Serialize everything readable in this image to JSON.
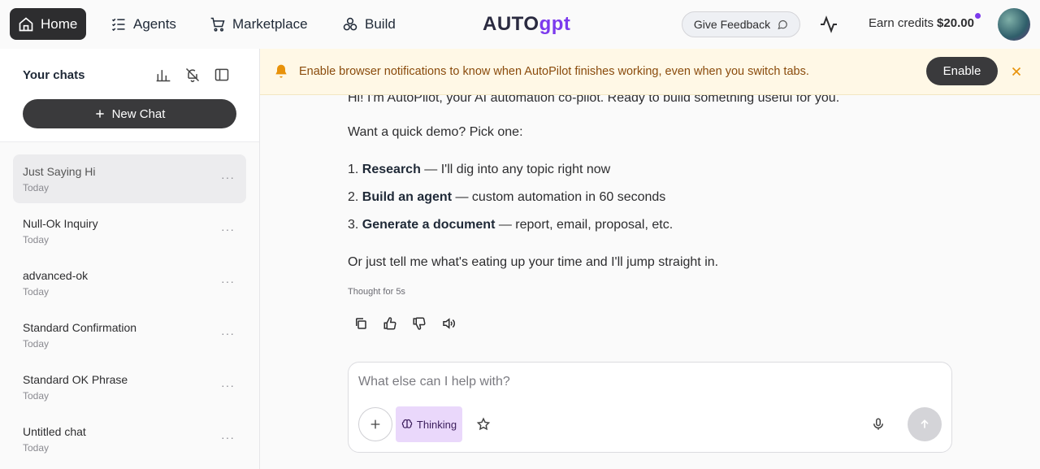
{
  "nav": {
    "home_label": "Home",
    "agents_label": "Agents",
    "marketplace_label": "Marketplace",
    "build_label": "Build",
    "logo_left": "AUTO",
    "logo_right": "gpt",
    "feedback_label": "Give Feedback",
    "credits_label": "Earn credits",
    "credits_value": "$20.00"
  },
  "sidebar": {
    "title": "Your chats",
    "new_chat_label": "New Chat",
    "chats": [
      {
        "title": "Just Saying Hi",
        "date": "Today",
        "active": true
      },
      {
        "title": "Null-Ok Inquiry",
        "date": "Today",
        "active": false
      },
      {
        "title": "advanced-ok",
        "date": "Today",
        "active": false
      },
      {
        "title": "Standard Confirmation",
        "date": "Today",
        "active": false
      },
      {
        "title": "Standard OK Phrase",
        "date": "Today",
        "active": false
      },
      {
        "title": "Untitled chat",
        "date": "Today",
        "active": false
      }
    ]
  },
  "banner": {
    "text": "Enable browser notifications to know when AutoPilot finishes working, even when you switch tabs.",
    "enable_label": "Enable"
  },
  "message": {
    "intro": "Hi! I'm AutoPilot, your AI automation co-pilot. Ready to build something useful for you.",
    "demo_prompt": "Want a quick demo? Pick one:",
    "options": [
      {
        "num": "1.",
        "bold": "Research",
        "rest": " — I'll dig into any topic right now"
      },
      {
        "num": "2.",
        "bold": "Build an agent",
        "rest": " — custom automation in 60 seconds"
      },
      {
        "num": "3.",
        "bold": "Generate a document",
        "rest": " — report, email, proposal, etc."
      }
    ],
    "closing": "Or just tell me what's eating up your time and I'll jump straight in.",
    "thought": "Thought for 5s"
  },
  "composer": {
    "placeholder": "What else can I help with?",
    "thinking_label": "Thinking"
  },
  "colors": {
    "accent": "#7c3aed",
    "dark_button": "#3a3a3c",
    "banner_bg": "#fff8e6",
    "banner_text": "#8a4b0c",
    "thinking_bg": "#ead8fb"
  }
}
